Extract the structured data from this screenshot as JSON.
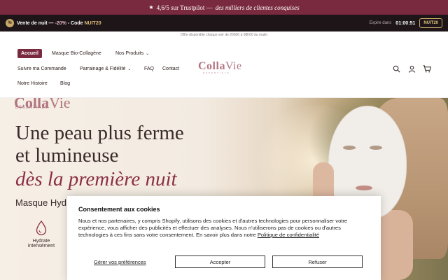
{
  "topbar": {
    "star": "★",
    "rating": "4,6/5 sur Trustpilot —",
    "tagline": "des milliers de clientes conquises"
  },
  "promo": {
    "badge": "%",
    "label": "Vente de nuit —",
    "discount": "-20%",
    "sep": "- Code",
    "code": "NUIT20",
    "expire_label": "Expire dans",
    "timer": "01:00:51",
    "code_button": "NUIT20"
  },
  "offer": "Offre disponible chaque soir de 20h00 à 08h00 du matin",
  "nav": {
    "home": "Accueil",
    "mask": "Masque Bio-Collagène",
    "products": "Nos Produits",
    "order": "Suivre ma Commande",
    "referral": "Parrainage & Fidélité",
    "faq": "FAQ",
    "contact": "Contact",
    "story": "Notre Histoire",
    "blog": "Blog"
  },
  "logo": {
    "part1": "Colla",
    "part2": "Vie",
    "sub": "ESSENTIALS"
  },
  "hero": {
    "brand_part1": "Colla",
    "brand_part2": "Vie",
    "brand_sub": "ESSENTIALS",
    "line1": "Une peau plus ferme",
    "line2": "et lumineuse",
    "line3": "dès la première nuit",
    "subtitle": "Masque Hyd",
    "feature": {
      "label1": "Hydrate",
      "label2": "intensément"
    }
  },
  "cookie": {
    "title": "Consentement aux cookies",
    "text": "Nous et nos partenaires, y compris Shopify, utilisons des cookies et d'autres technologies pour personnaliser votre expérience, vous afficher des publicités et effectuer des analyses. Nous n'utiliserons pas de cookies ou d'autres technologies à ces fins sans votre consentement. En savoir plus dans notre ",
    "link": "Politique de confidentialité",
    "prefs": "Gérer vos préférences",
    "accept": "Accepter",
    "reject": "Refuser"
  },
  "colors": {
    "brand": "#7a2a3f",
    "accent": "#8a2e45",
    "gold": "#c9a96a"
  },
  "icons": [
    "search-icon",
    "account-icon",
    "cart-icon",
    "chevron-down-icon",
    "droplet-icon"
  ]
}
